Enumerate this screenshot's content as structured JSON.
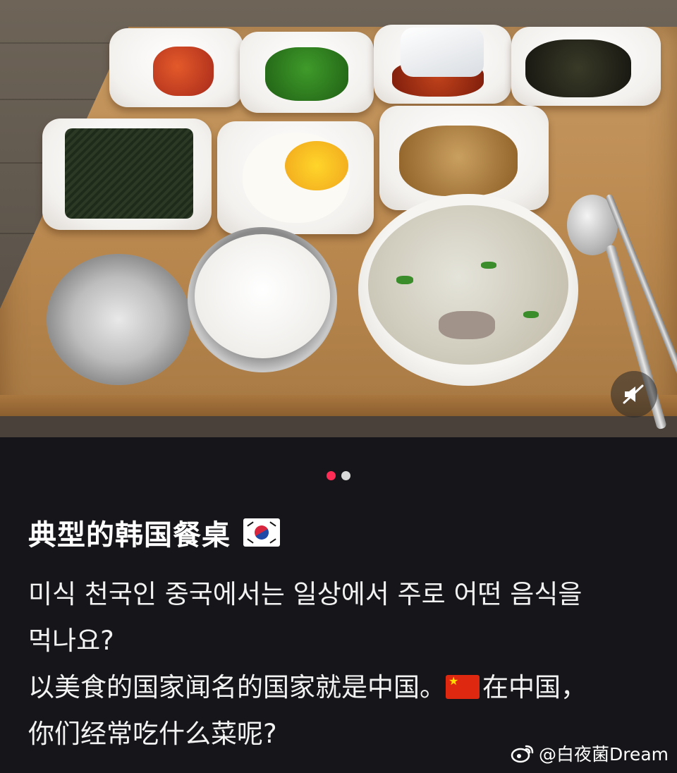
{
  "carousel": {
    "page_count": 2,
    "current_page": 1,
    "active_color": "#ff2d55",
    "inactive_color": "#d9d9d9"
  },
  "post": {
    "title": "典型的韩国餐桌",
    "title_flag_icon": "south-korea-flag-icon",
    "lines": [
      "미식 천국인 중국에서는 일상에서 주로 어떤 음식을",
      "먹나요?",
      "以美食的国家闻名的国家就是中国。",
      "在中国，",
      "你们经常吃什么菜呢?"
    ],
    "inline_flag_icon": "china-flag-icon"
  },
  "watermark": {
    "icon": "weibo-logo-icon",
    "text": "@白夜菌Dream"
  },
  "photo": {
    "description_icon": "korean-meal-tray-photo",
    "mute_button_icon": "sound-off-icon"
  }
}
